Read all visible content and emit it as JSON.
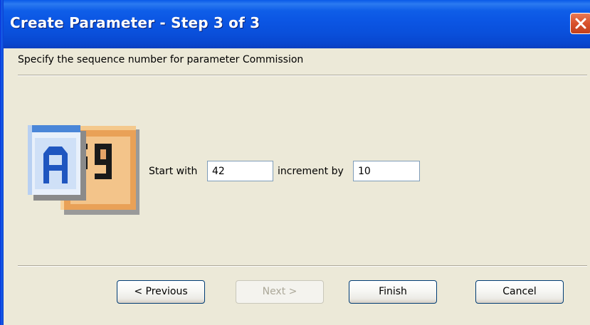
{
  "window": {
    "title": "Create Parameter - Step 3 of 3",
    "close_icon": "close-icon",
    "colors": {
      "titlebar": "#0a55e3",
      "close_button": "#d8512b",
      "background": "#ece9d8"
    }
  },
  "content": {
    "instruction": "Specify the sequence number for parameter Commission",
    "icon": "sequence-wizard-icon",
    "start": {
      "label": "Start with",
      "value": "42"
    },
    "increment": {
      "label": "increment by",
      "value": "10"
    }
  },
  "buttons": {
    "previous": "< Previous",
    "next": "Next >",
    "finish": "Finish",
    "cancel": "Cancel"
  }
}
